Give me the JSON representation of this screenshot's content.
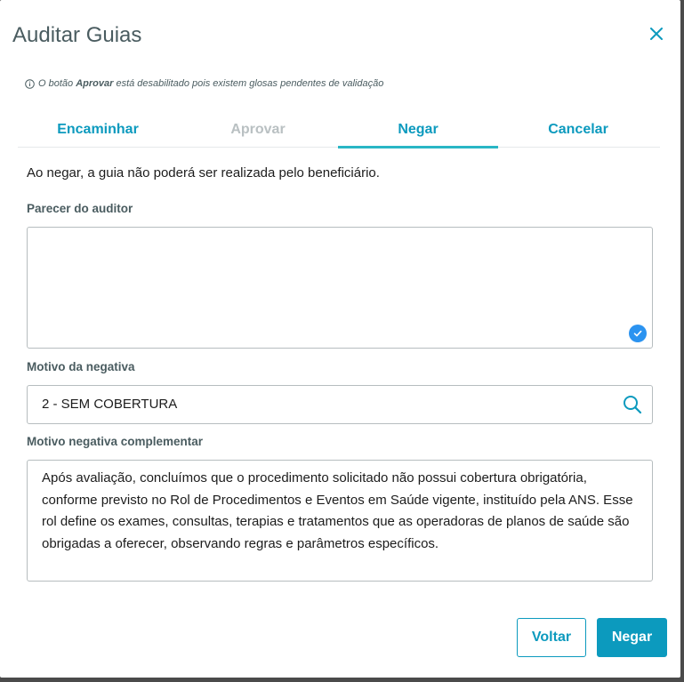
{
  "dialog": {
    "title": "Auditar Guias",
    "info": {
      "prefix": "O botão ",
      "highlight": "Aprovar",
      "suffix": " está desabilitado pois existem glosas pendentes de validação"
    }
  },
  "tabs": [
    {
      "label": "Encaminhar",
      "state": "enabled"
    },
    {
      "label": "Aprovar",
      "state": "disabled"
    },
    {
      "label": "Negar",
      "state": "active"
    },
    {
      "label": "Cancelar",
      "state": "enabled"
    }
  ],
  "form": {
    "description": "Ao negar, a guia não poderá ser realizada pelo beneficiário.",
    "parecer_label": "Parecer do auditor",
    "parecer_value": "",
    "motivo_label": "Motivo da negativa",
    "motivo_value": "2 - SEM COBERTURA",
    "complementar_label": "Motivo negativa complementar",
    "complementar_value": "Após avaliação, concluímos que o procedimento solicitado não possui cobertura obrigatória, conforme previsto no Rol de Procedimentos e Eventos em Saúde vigente, instituído pela ANS. Esse rol define os exames, consultas, terapias e tratamentos que as operadoras de planos de saúde são obrigadas a oferecer, observando regras e parâmetros específicos."
  },
  "buttons": {
    "back_label": "Voltar",
    "deny_label": "Negar"
  },
  "icons": {
    "close": "close-icon",
    "info": "info-icon",
    "check": "check-circle-icon",
    "search": "search-icon"
  },
  "colors": {
    "primary": "#0c9abe",
    "tab_indicator": "#29b6c5",
    "disabled": "#b9c0c2",
    "check": "#2b93f0"
  }
}
